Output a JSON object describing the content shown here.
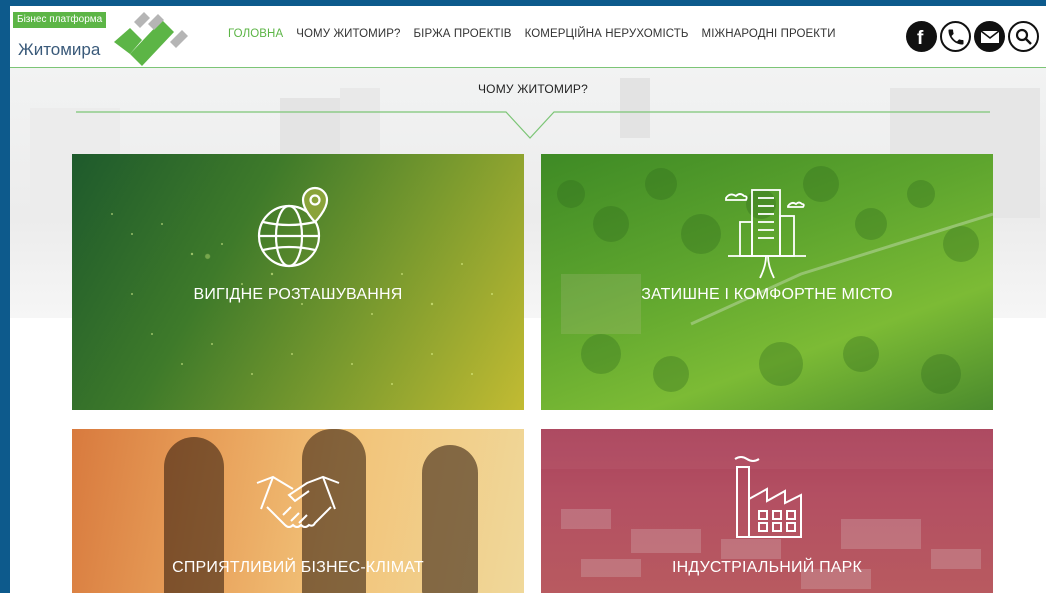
{
  "logo": {
    "badge": "Бізнес платформа",
    "city": "Житомира"
  },
  "nav": {
    "items": [
      {
        "label": "ГОЛОВНА",
        "active": true
      },
      {
        "label": "ЧОМУ ЖИТОМИР?",
        "active": false
      },
      {
        "label": "БІРЖА ПРОЕКТІВ",
        "active": false
      },
      {
        "label": "КОМЕРЦІЙНА НЕРУХОМІСТЬ",
        "active": false
      },
      {
        "label": "МІЖНАРОДНІ ПРОЕКТИ",
        "active": false
      }
    ]
  },
  "socials": [
    {
      "icon": "facebook-icon"
    },
    {
      "icon": "phone-icon"
    },
    {
      "icon": "email-icon"
    },
    {
      "icon": "search-icon"
    }
  ],
  "section": {
    "title": "ЧОМУ ЖИТОМИР?"
  },
  "tiles": [
    {
      "label": "ВИГІДНЕ РОЗТАШУВАННЯ",
      "icon": "globe-pin-icon"
    },
    {
      "label": "ЗАТИШНЕ І КОМФОРТНЕ МІСТО",
      "icon": "city-building-icon"
    },
    {
      "label": "СПРИЯТЛИВИЙ БІЗНЕС-КЛІМАТ",
      "icon": "handshake-icon"
    },
    {
      "label": "ІНДУСТРІАЛЬНИЙ ПАРК",
      "icon": "factory-icon"
    }
  ],
  "colors": {
    "accent": "#5cb546",
    "frame": "#0d5a8c",
    "divider": "#7cc576"
  }
}
